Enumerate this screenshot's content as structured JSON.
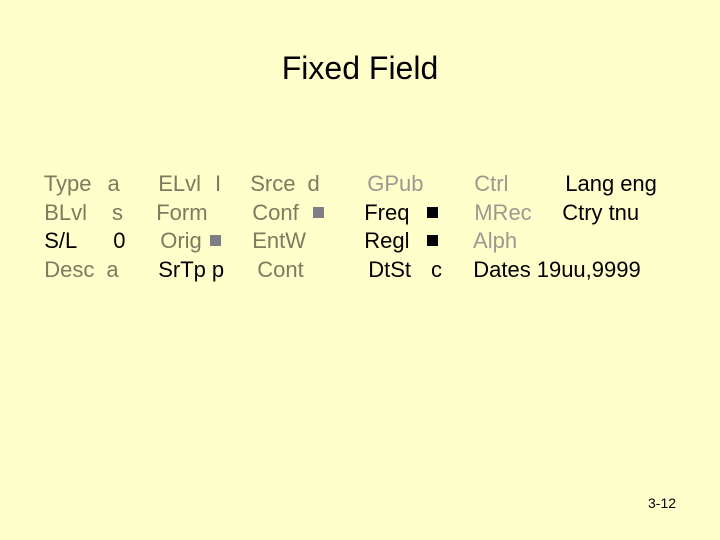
{
  "title": "Fixed Field",
  "page_number": "3-12",
  "colors": {
    "background": "#FFFFCC",
    "olive_text": "#7B7B5F",
    "gray_text": "#9A9A90",
    "black_text": "#000000"
  },
  "fields": {
    "type": {
      "label": "Type",
      "value": "a"
    },
    "blvl": {
      "label": "BLvl",
      "value": "s"
    },
    "sl": {
      "label": "S/L",
      "value": "0"
    },
    "desc": {
      "label": "Desc",
      "value": "a"
    },
    "elvl": {
      "label": "ELvl",
      "value": "I"
    },
    "form": {
      "label": "Form",
      "value": ""
    },
    "orig": {
      "label": "Orig",
      "value": "fill-char-square"
    },
    "srtp": {
      "label": "SrTp",
      "value": "p"
    },
    "srce": {
      "label": "Srce",
      "value": "d"
    },
    "conf": {
      "label": "Conf",
      "value": "fill-char-square"
    },
    "entw": {
      "label": "EntW",
      "value": ""
    },
    "cont": {
      "label": "Cont",
      "value": ""
    },
    "gpub": {
      "label": "GPub",
      "value": ""
    },
    "freq": {
      "label": "Freq",
      "value": "fill-char-square"
    },
    "regl": {
      "label": "Regl",
      "value": "fill-char-square"
    },
    "dtst": {
      "label": "DtSt",
      "value": "c"
    },
    "ctrl": {
      "label": "Ctrl",
      "value": ""
    },
    "mrec": {
      "label": "MRec",
      "value": ""
    },
    "alph": {
      "label": "Alph",
      "value": ""
    },
    "dates": {
      "label": "Dates",
      "value": "19uu,9999"
    },
    "lang": {
      "label": "Lang",
      "value": "eng"
    },
    "ctry": {
      "label": "Ctry",
      "value": "tnu"
    }
  }
}
